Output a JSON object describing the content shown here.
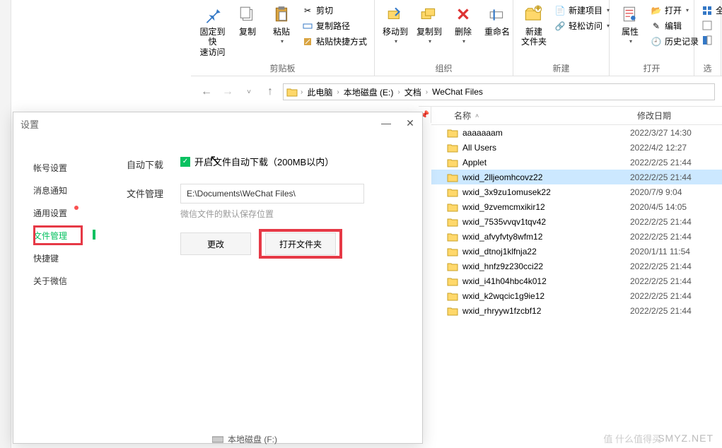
{
  "ribbon": {
    "pin": {
      "label": "固定到快\n速访问"
    },
    "copy": {
      "label": "复制"
    },
    "paste": {
      "label": "粘贴"
    },
    "cut": {
      "label": "剪切"
    },
    "copypath": {
      "label": "复制路径"
    },
    "pasteshortcut": {
      "label": "粘贴快捷方式"
    },
    "moveto": {
      "label": "移动到"
    },
    "copyto": {
      "label": "复制到"
    },
    "delete": {
      "label": "删除"
    },
    "rename": {
      "label": "重命名"
    },
    "newfolder": {
      "label": "新建\n文件夹"
    },
    "newitem": {
      "label": "新建项目"
    },
    "easyaccess": {
      "label": "轻松访问"
    },
    "properties": {
      "label": "属性"
    },
    "open": {
      "label": "打开"
    },
    "edit": {
      "label": "编辑"
    },
    "history": {
      "label": "历史记录"
    },
    "selectall": {
      "label": "全"
    },
    "grp_clipboard": "剪贴板",
    "grp_organize": "组织",
    "grp_new": "新建",
    "grp_open": "打开",
    "grp_select": "选"
  },
  "crumb": {
    "segs": [
      "此电脑",
      "本地磁盘 (E:)",
      "文档",
      "WeChat Files"
    ]
  },
  "filehead": {
    "name": "名称",
    "date": "修改日期"
  },
  "files": [
    {
      "name": "aaaaaaam",
      "date": "2022/3/27 14:30"
    },
    {
      "name": "All Users",
      "date": "2022/4/2 12:27"
    },
    {
      "name": "Applet",
      "date": "2022/2/25 21:44"
    },
    {
      "name": "wxid_2lljeomhcovz22",
      "date": "2022/2/25 21:44",
      "sel": true
    },
    {
      "name": "wxid_3x9zu1omusek22",
      "date": "2020/7/9 9:04"
    },
    {
      "name": "wxid_9zvemcmxikir12",
      "date": "2020/4/5 14:05"
    },
    {
      "name": "wxid_7535vvqv1tqv42",
      "date": "2022/2/25 21:44"
    },
    {
      "name": "wxid_afvyfvty8wfm12",
      "date": "2022/2/25 21:44"
    },
    {
      "name": "wxid_dtnoj1klfnja22",
      "date": "2020/1/11 11:54"
    },
    {
      "name": "wxid_hnfz9z230cci22",
      "date": "2022/2/25 21:44"
    },
    {
      "name": "wxid_i41h04hbc4k012",
      "date": "2022/2/25 21:44"
    },
    {
      "name": "wxid_k2wqcic1g9ie12",
      "date": "2022/2/25 21:44"
    },
    {
      "name": "wxid_rhryyw1fzcbf12",
      "date": "2022/2/25 21:44"
    }
  ],
  "dlg": {
    "title": "设置",
    "side": [
      "帐号设置",
      "消息通知",
      "通用设置",
      "文件管理",
      "快捷键",
      "关于微信"
    ],
    "autodl_label": "自动下载",
    "autodl_text": "开启文件自动下载（200MB以内）",
    "mgmt_label": "文件管理",
    "path": "E:\\Documents\\WeChat Files\\",
    "hint": "微信文件的默认保存位置",
    "btn_change": "更改",
    "btn_open": "打开文件夹"
  },
  "bottom_drive": "本地磁盘 (F:)",
  "wm1": "SMYZ.NET",
  "wm2": "值 什么值得买"
}
